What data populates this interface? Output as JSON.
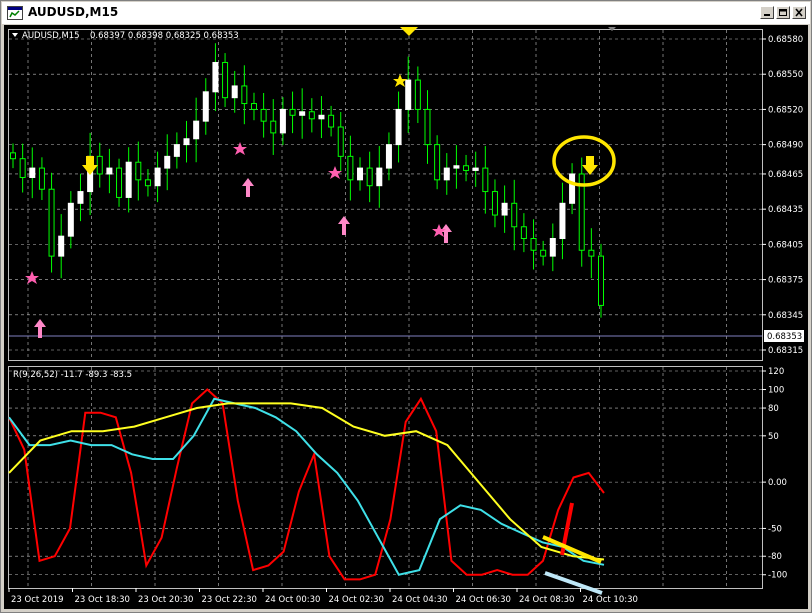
{
  "window": {
    "title": "AUDUSD,M15",
    "minimize_icon": "minimize-icon",
    "restore_icon": "restore-icon",
    "close_icon": "close-icon"
  },
  "chart": {
    "symbol_label": "AUDUSD,M15",
    "ohlc_label": "0.68397 0.68398 0.68325 0.68353",
    "current_price_label": "0.68353",
    "indicator_label": "R(9,26,52) -11.7 -89.3 -83.5",
    "colors": {
      "background": "#000000",
      "bull_candle": "#ffffff",
      "wick": "#00ff00",
      "grid": "#c0c0c0",
      "indicator_red": "#ff0000",
      "indicator_cyan": "#3fe0e8",
      "indicator_yellow": "#ffff20",
      "arrow_up": "#ff88c8",
      "signal_down": "#ffe600"
    }
  },
  "chart_data": [
    {
      "type": "candlestick",
      "price_ylim": [
        0.68315,
        0.6858
      ],
      "price_ticks": [
        "0.68580",
        "0.68550",
        "0.68520",
        "0.68490",
        "0.68465",
        "0.68435",
        "0.68405",
        "0.68375",
        "0.68345",
        "0.68315"
      ],
      "time_ticks": [
        "23 Oct 2019",
        "23 Oct 18:30",
        "23 Oct 20:30",
        "23 Oct 22:30",
        "24 Oct 00:30",
        "24 Oct 02:30",
        "24 Oct 04:30",
        "24 Oct 06:30",
        "24 Oct 08:30",
        "24 Oct 10:30"
      ],
      "closes": [
        0.68478,
        0.68462,
        0.6847,
        0.68452,
        0.68395,
        0.68412,
        0.6844,
        0.6845,
        0.6848,
        0.68465,
        0.6847,
        0.68445,
        0.68475,
        0.6846,
        0.68455,
        0.6847,
        0.6848,
        0.6849,
        0.68495,
        0.6851,
        0.68535,
        0.6856,
        0.6853,
        0.6854,
        0.68525,
        0.6852,
        0.6851,
        0.685,
        0.6852,
        0.68515,
        0.68518,
        0.68512,
        0.68515,
        0.68505,
        0.6848,
        0.6846,
        0.6847,
        0.68455,
        0.6847,
        0.6849,
        0.6852,
        0.68545,
        0.6852,
        0.6849,
        0.6846,
        0.6847,
        0.68472,
        0.68468,
        0.6847,
        0.6845,
        0.6843,
        0.6844,
        0.6842,
        0.6841,
        0.684,
        0.68395,
        0.6841,
        0.6844,
        0.68465,
        0.684,
        0.68395,
        0.68353
      ]
    },
    {
      "type": "line",
      "title": "R(9,26,52) -11.7 -89.3 -83.5",
      "ylim": [
        -110,
        120
      ],
      "yticks": [
        120,
        100,
        80,
        50,
        0.0,
        -50,
        -80,
        -100
      ],
      "ytick_labels": [
        "120",
        "100",
        "80",
        "50",
        "0.00",
        "-50",
        "-80",
        "-100"
      ],
      "series": [
        {
          "color": "#ff0000",
          "values": [
            70,
            35,
            -85,
            -80,
            -50,
            75,
            75,
            70,
            10,
            -90,
            -60,
            15,
            85,
            100,
            85,
            -20,
            -95,
            -90,
            -75,
            -10,
            30,
            -80,
            -105,
            -105,
            -100,
            -40,
            65,
            90,
            55,
            -85,
            -100,
            -100,
            -95,
            -100,
            -100,
            -85,
            -30,
            5,
            10,
            -11.7
          ]
        },
        {
          "color": "#3fe0e8",
          "values": [
            70,
            40,
            40,
            45,
            40,
            40,
            30,
            25,
            25,
            50,
            90,
            85,
            80,
            70,
            55,
            30,
            10,
            -20,
            -60,
            -100,
            -95,
            -40,
            -25,
            -30,
            -45,
            -55,
            -65,
            -70,
            -85,
            -89.3
          ]
        },
        {
          "color": "#ffff20",
          "values": [
            10,
            45,
            55,
            55,
            60,
            70,
            80,
            85,
            85,
            85,
            80,
            60,
            50,
            55,
            40,
            0,
            -40,
            -70,
            -80,
            -83.5
          ]
        }
      ]
    }
  ]
}
